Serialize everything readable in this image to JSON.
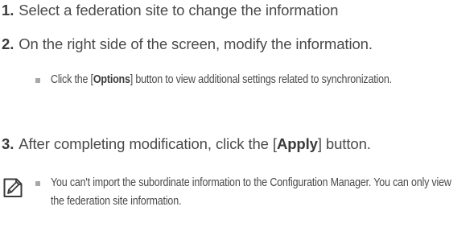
{
  "steps": [
    {
      "number": "1.",
      "text": "Select a federation site to change the information"
    },
    {
      "number": "2.",
      "text": "On the right side of the screen, modify the information."
    },
    {
      "number": "3.",
      "text_before": "After completing modification, click the [",
      "button_label": "Apply",
      "text_after": "] button."
    }
  ],
  "sub_bullet": {
    "text_before": "Click the [",
    "button_label": "Options",
    "text_after": "] button to view additional settings related to synchronization."
  },
  "note": {
    "icon": "note-pencil-icon",
    "text": "You can't import the subordinate information to the Configuration Manager. You can only view the federation site information."
  },
  "colors": {
    "text": "#4a4a4a",
    "bullet": "#a8a8a8",
    "icon": "#3a3a3a"
  }
}
